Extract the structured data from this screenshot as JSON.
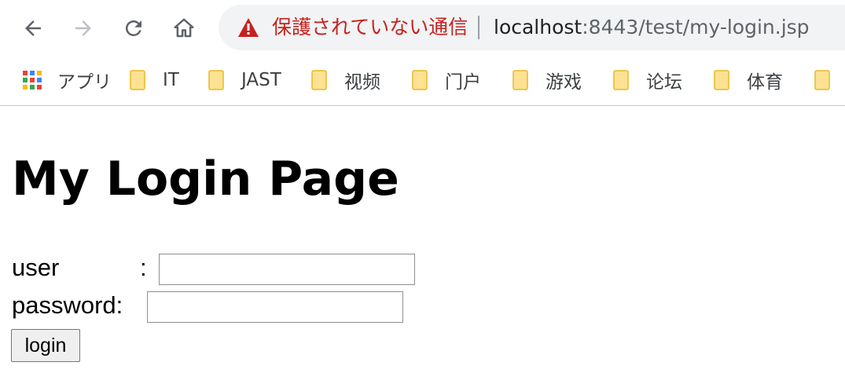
{
  "browser": {
    "security_warning": "保護されていない通信",
    "url_host": "localhost",
    "url_path": ":8443/test/my-login.jsp",
    "bookmarks": [
      {
        "label": "アプリ",
        "icon": "apps-grid-icon"
      },
      {
        "label": "IT",
        "icon": "folder-icon"
      },
      {
        "label": "JAST",
        "icon": "folder-icon"
      },
      {
        "label": "视频",
        "icon": "folder-icon"
      },
      {
        "label": "门户",
        "icon": "folder-icon"
      },
      {
        "label": "游戏",
        "icon": "folder-icon"
      },
      {
        "label": "论坛",
        "icon": "folder-icon"
      },
      {
        "label": "体育",
        "icon": "folder-icon"
      },
      {
        "label": "",
        "icon": "folder-icon"
      }
    ],
    "colors": {
      "warning": "#c5221f",
      "folder": "#fcd766",
      "omnibox_bg": "#f1f3f4"
    }
  },
  "page": {
    "title": "My Login Page",
    "user_label": "user",
    "user_colon": ":",
    "password_label": "password:",
    "user_value": "",
    "password_value": "",
    "login_label": "login"
  }
}
